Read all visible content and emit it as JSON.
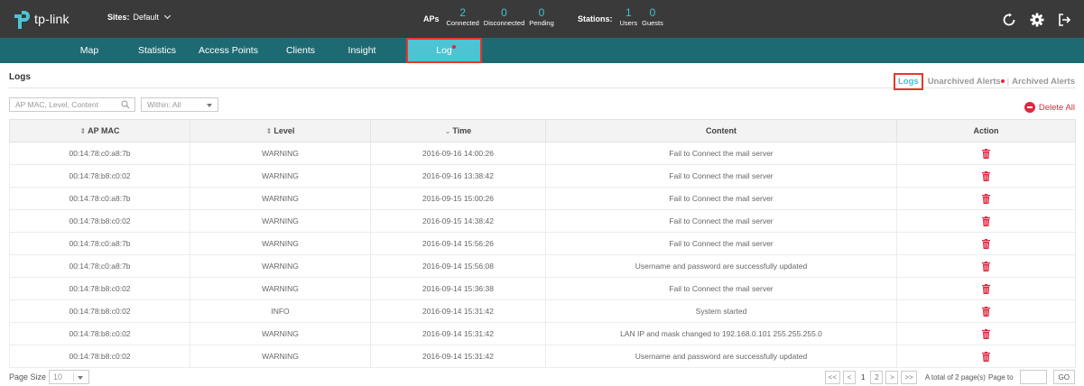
{
  "header": {
    "logo_text": "tp-link",
    "sites_label": "Sites:",
    "sites_value": "Default",
    "aps_label": "APs",
    "aps": [
      {
        "num": "2",
        "name": "Connected"
      },
      {
        "num": "0",
        "name": "Disconnected"
      },
      {
        "num": "0",
        "name": "Pending"
      }
    ],
    "stations_label": "Stations:",
    "stations": [
      {
        "num": "1",
        "name": "Users"
      },
      {
        "num": "0",
        "name": "Guests"
      }
    ],
    "icons": [
      "refresh-icon",
      "gear-icon",
      "logout-icon"
    ]
  },
  "nav": {
    "items": [
      "Map",
      "Statistics",
      "Access Points",
      "Clients",
      "Insight",
      "Log"
    ],
    "active": "Log"
  },
  "page": {
    "title": "Logs",
    "subtabs": {
      "logs": "Logs",
      "unarchived": "Unarchived Alerts",
      "separator": "|",
      "archived": "Archived Alerts"
    }
  },
  "toolbar": {
    "search_placeholder": "AP MAC, Level, Content",
    "within_label": "Within: All",
    "delete_all": "Delete All"
  },
  "table": {
    "columns": [
      "AP MAC",
      "Level",
      "Time",
      "Content",
      "Action"
    ],
    "rows": [
      {
        "mac": "00:14:78:c0:a8:7b",
        "level": "WARNING",
        "time": "2016-09-16 14:00:26",
        "content": "Fail to Connect the mail server"
      },
      {
        "mac": "00:14:78:b8:c0:02",
        "level": "WARNING",
        "time": "2016-09-16 13:38:42",
        "content": "Fail to Connect the mail server"
      },
      {
        "mac": "00:14:78:c0:a8:7b",
        "level": "WARNING",
        "time": "2016-09-15 15:00:26",
        "content": "Fail to Connect the mail server"
      },
      {
        "mac": "00:14:78:b8:c0:02",
        "level": "WARNING",
        "time": "2016-09-15 14:38:42",
        "content": "Fail to Connect the mail server"
      },
      {
        "mac": "00:14:78:c0:a8:7b",
        "level": "WARNING",
        "time": "2016-09-14 15:56:26",
        "content": "Fail to Connect the mail server"
      },
      {
        "mac": "00:14:78:c0:a8:7b",
        "level": "WARNING",
        "time": "2016-09-14 15:56:08",
        "content": "Username and password are successfully updated"
      },
      {
        "mac": "00:14:78:b8:c0:02",
        "level": "WARNING",
        "time": "2016-09-14 15:36:38",
        "content": "Fail to Connect the mail server"
      },
      {
        "mac": "00:14:78:b8:c0:02",
        "level": "INFO",
        "time": "2016-09-14 15:31:42",
        "content": "System started"
      },
      {
        "mac": "00:14:78:b8:c0:02",
        "level": "WARNING",
        "time": "2016-09-14 15:31:42",
        "content": "LAN IP and mask changed to 192.168.0.101 255.255.255.0"
      },
      {
        "mac": "00:14:78:b8:c0:02",
        "level": "WARNING",
        "time": "2016-09-14 15:31:42",
        "content": "Username and password are successfully updated"
      }
    ]
  },
  "footer": {
    "page_size_label": "Page Size",
    "page_size_value": "10",
    "first": "<<",
    "prev": "<",
    "pages": [
      "1",
      "2"
    ],
    "next": ">",
    "last": ">>",
    "total_text": "A total of 2 page(s)",
    "page_to_label": "Page to",
    "go": "GO"
  },
  "colors": {
    "header_bg": "#3a3a3a",
    "nav_bg": "#1d6a73",
    "nav_active": "#4cc4d4",
    "accent": "#3fc4cf",
    "danger": "#e0273f",
    "highlight": "#e8372b"
  }
}
